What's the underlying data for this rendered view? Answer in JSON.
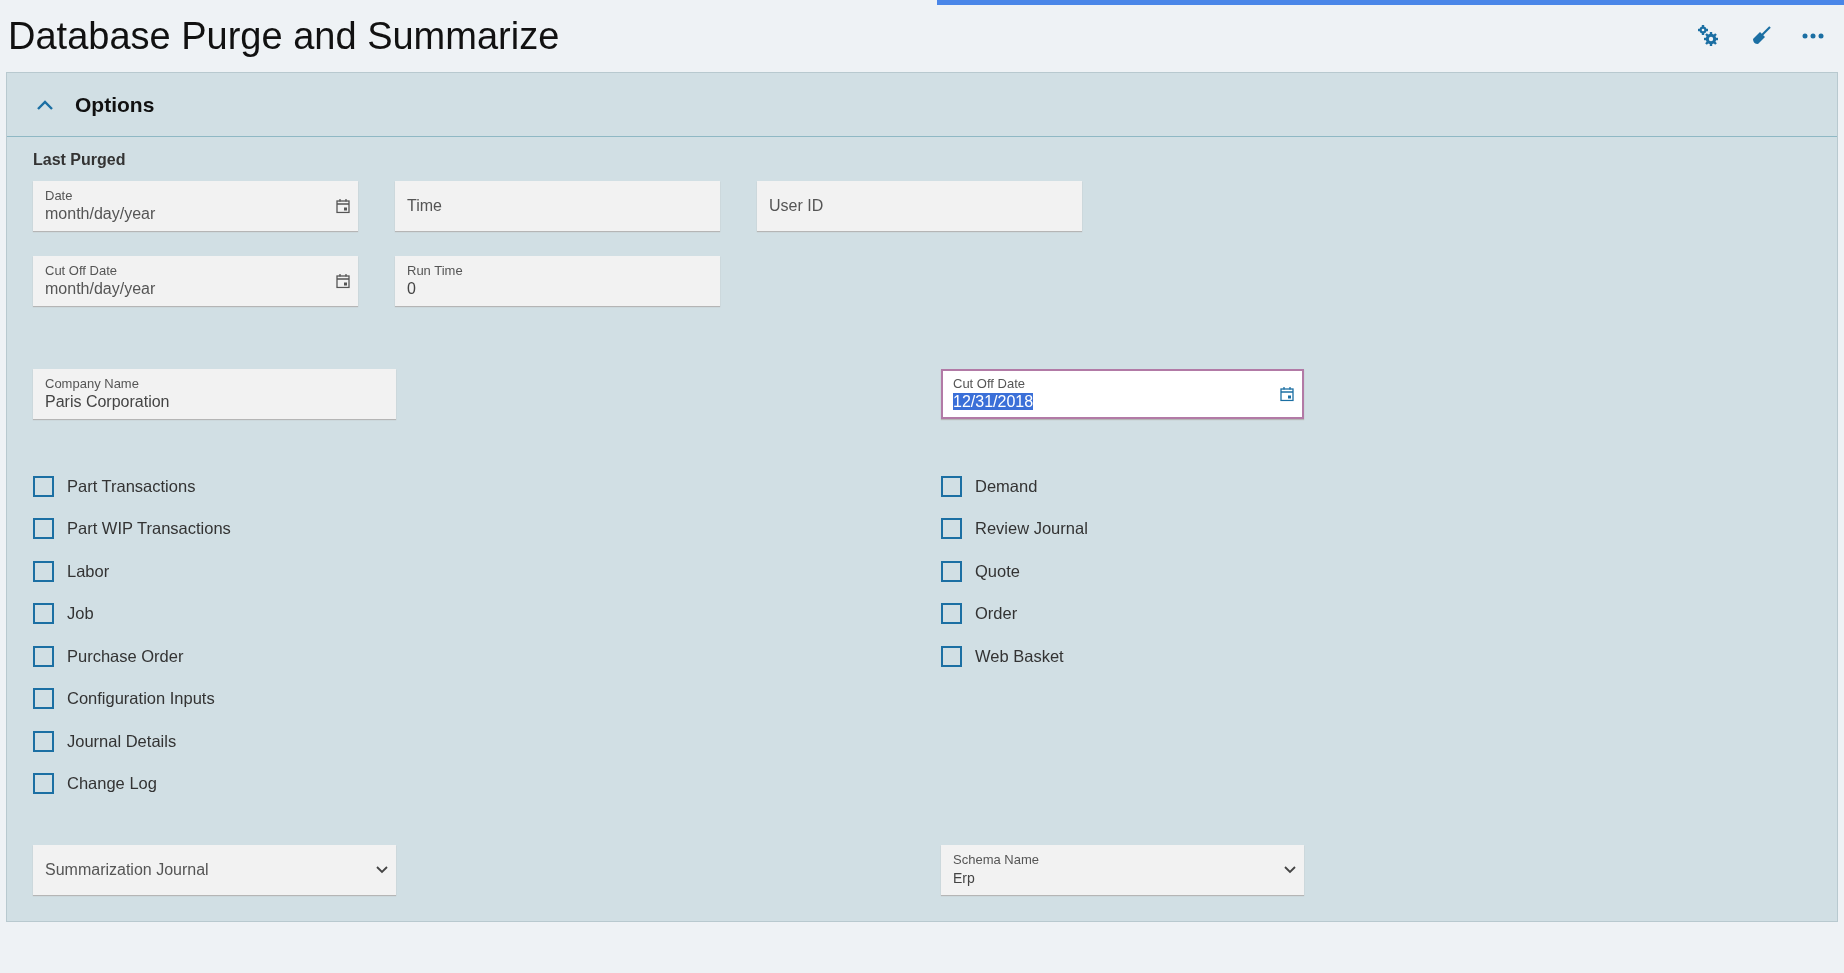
{
  "page": {
    "title": "Database Purge and Summarize"
  },
  "toolbar": {
    "buttons": [
      {
        "kind": "gears"
      },
      {
        "kind": "broom"
      },
      {
        "kind": "more"
      }
    ]
  },
  "options_panel": {
    "title": "Options",
    "expanded": true,
    "last_purged": {
      "heading": "Last Purged",
      "rows": [
        [
          {
            "kind": "date",
            "label": "Date",
            "placeholder": "month/day/year"
          },
          {
            "placeholder": "Time"
          },
          {
            "placeholder": "User ID"
          }
        ],
        [
          {
            "kind": "date",
            "label": "Cut Off Date",
            "placeholder": "month/day/year"
          },
          {
            "label": "Run Time",
            "value": "0"
          }
        ]
      ]
    },
    "company_name": {
      "label": "Company Name",
      "value": "Paris Corporation"
    },
    "cut_off_date": {
      "kind": "date",
      "label": "Cut Off Date",
      "value": "12/31/2018",
      "focused": true
    },
    "left_checkboxes": [
      {
        "label": "Part Transactions",
        "checked": false
      },
      {
        "label": "Part WIP Transactions",
        "checked": false
      },
      {
        "label": "Labor",
        "checked": false
      },
      {
        "label": "Job",
        "checked": false
      },
      {
        "label": "Purchase Order",
        "checked": false
      },
      {
        "label": "Configuration Inputs",
        "checked": false
      },
      {
        "label": "Journal Details",
        "checked": false
      },
      {
        "label": "Change Log",
        "checked": false
      }
    ],
    "right_checkboxes": [
      {
        "label": "Demand",
        "checked": false
      },
      {
        "label": "Review Journal",
        "checked": false
      },
      {
        "label": "Quote",
        "checked": false
      },
      {
        "label": "Order",
        "checked": false
      },
      {
        "label": "Web Basket",
        "checked": false
      }
    ],
    "summarization_journal": {
      "kind": "select",
      "placeholder": "Summarization Journal"
    },
    "schema_name": {
      "kind": "select",
      "label": "Schema Name",
      "value": "Erp"
    }
  }
}
